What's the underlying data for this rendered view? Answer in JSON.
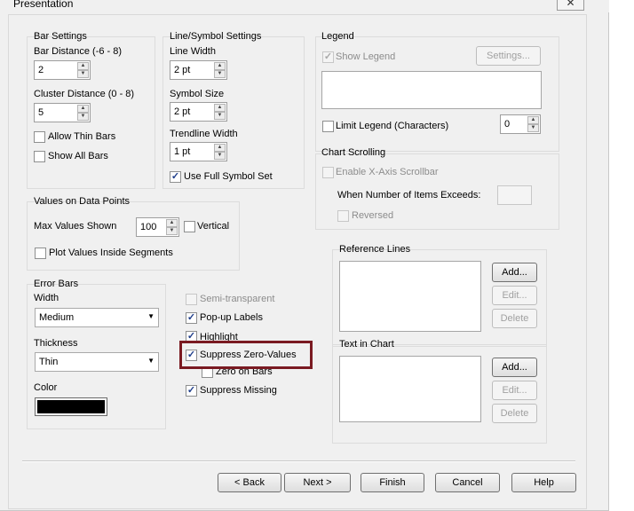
{
  "window": {
    "title": "Presentation",
    "close_glyph": "✕"
  },
  "bar_settings": {
    "title": "Bar Settings",
    "bar_distance": {
      "label": "Bar Distance (-6 - 8)",
      "value": "2"
    },
    "cluster_distance": {
      "label": "Cluster Distance (0 - 8)",
      "value": "5"
    },
    "allow_thin_bars": {
      "label": "Allow Thin Bars",
      "checked": false
    },
    "show_all_bars": {
      "label": "Show All Bars",
      "checked": false
    }
  },
  "line_symbol": {
    "title": "Line/Symbol Settings",
    "line_width": {
      "label": "Line Width",
      "value": "2 pt"
    },
    "symbol_size": {
      "label": "Symbol Size",
      "value": "2 pt"
    },
    "trendline_width": {
      "label": "Trendline Width",
      "value": "1 pt"
    },
    "use_full_symbol_set": {
      "label": "Use Full Symbol Set",
      "checked": true
    }
  },
  "legend": {
    "title": "Legend",
    "show_legend": {
      "label": "Show Legend",
      "checked": true,
      "disabled": true
    },
    "settings_button": "Settings...",
    "limit_legend": {
      "label": "Limit Legend (Characters)",
      "checked": false,
      "value": "0"
    }
  },
  "chart_scrolling": {
    "title": "Chart Scrolling",
    "enable_scrollbar": {
      "label": "Enable X-Axis Scrollbar",
      "checked": false
    },
    "when_exceeds_label": "When Number of Items Exceeds:",
    "reversed": {
      "label": "Reversed",
      "checked": false
    }
  },
  "values_on_points": {
    "title": "Values on Data Points",
    "max_values": {
      "label": "Max Values Shown",
      "value": "100"
    },
    "vertical": {
      "label": "Vertical",
      "checked": false
    },
    "plot_inside": {
      "label": "Plot Values Inside Segments",
      "checked": false
    }
  },
  "error_bars": {
    "title": "Error Bars",
    "width_label": "Width",
    "width_value": "Medium",
    "thickness_label": "Thickness",
    "thickness_value": "Thin",
    "color_label": "Color",
    "color_value": "#000000"
  },
  "options": {
    "semi_transparent": {
      "label": "Semi-transparent",
      "checked": false,
      "disabled": true
    },
    "popup_labels": {
      "label": "Pop-up Labels",
      "checked": true
    },
    "highlight": {
      "label": "Highlight",
      "checked": true
    },
    "suppress_zero": {
      "label": "Suppress Zero-Values",
      "checked": true
    },
    "zero_on_bars": {
      "label": "Zero on Bars",
      "checked": false
    },
    "suppress_missing": {
      "label": "Suppress Missing",
      "checked": true
    }
  },
  "reference_lines": {
    "title": "Reference Lines",
    "add": "Add...",
    "edit": "Edit...",
    "delete": "Delete"
  },
  "text_in_chart": {
    "title": "Text in Chart",
    "add": "Add...",
    "edit": "Edit...",
    "delete": "Delete"
  },
  "footer": {
    "back": "< Back",
    "next": "Next >",
    "finish": "Finish",
    "cancel": "Cancel",
    "help": "Help"
  },
  "check_glyph": "✓",
  "arrow_glyph": "▼",
  "up_glyph": "▲",
  "down_glyph": "▼",
  "highlight_color": "#7a1a21"
}
